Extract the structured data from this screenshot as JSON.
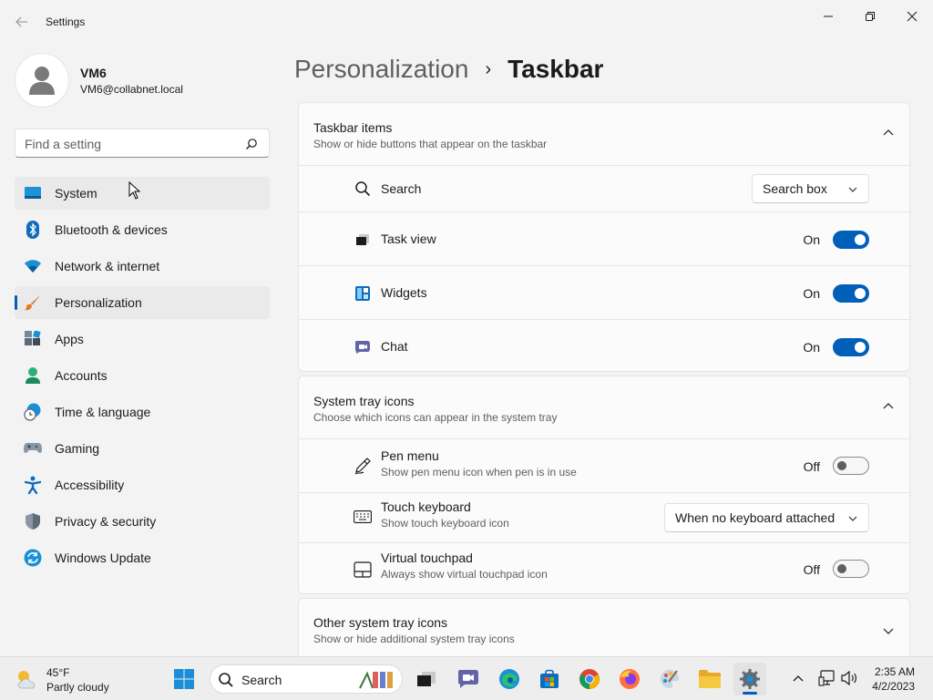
{
  "window": {
    "app_title": "Settings"
  },
  "profile": {
    "name": "VM6",
    "email": "VM6@collabnet.local"
  },
  "search": {
    "placeholder": "Find a setting"
  },
  "sidebar": {
    "items": [
      {
        "label": "System",
        "icon": "system-icon",
        "state": "hover"
      },
      {
        "label": "Bluetooth & devices",
        "icon": "bluetooth-icon"
      },
      {
        "label": "Network & internet",
        "icon": "wifi-icon"
      },
      {
        "label": "Personalization",
        "icon": "brush-icon",
        "state": "selected"
      },
      {
        "label": "Apps",
        "icon": "apps-icon"
      },
      {
        "label": "Accounts",
        "icon": "accounts-icon"
      },
      {
        "label": "Time & language",
        "icon": "globe-clock-icon"
      },
      {
        "label": "Gaming",
        "icon": "gamepad-icon"
      },
      {
        "label": "Accessibility",
        "icon": "accessibility-icon"
      },
      {
        "label": "Privacy & security",
        "icon": "shield-icon"
      },
      {
        "label": "Windows Update",
        "icon": "update-icon"
      }
    ]
  },
  "breadcrumb": {
    "parent": "Personalization",
    "separator": "›",
    "current": "Taskbar"
  },
  "taskbar_items": {
    "title": "Taskbar items",
    "description": "Show or hide buttons that appear on the taskbar",
    "rows": [
      {
        "label": "Search",
        "icon": "search-icon",
        "control": "dropdown",
        "value": "Search box"
      },
      {
        "label": "Task view",
        "icon": "task-view-icon",
        "control": "toggle",
        "state_label": "On",
        "on": true
      },
      {
        "label": "Widgets",
        "icon": "widgets-icon",
        "control": "toggle",
        "state_label": "On",
        "on": true
      },
      {
        "label": "Chat",
        "icon": "chat-icon",
        "control": "toggle",
        "state_label": "On",
        "on": true
      }
    ]
  },
  "system_tray": {
    "title": "System tray icons",
    "description": "Choose which icons can appear in the system tray",
    "rows": [
      {
        "label": "Pen menu",
        "sub": "Show pen menu icon when pen is in use",
        "icon": "pen-icon",
        "control": "toggle",
        "state_label": "Off",
        "on": false
      },
      {
        "label": "Touch keyboard",
        "sub": "Show touch keyboard icon",
        "icon": "keyboard-icon",
        "control": "dropdown",
        "value": "When no keyboard attached"
      },
      {
        "label": "Virtual touchpad",
        "sub": "Always show virtual touchpad icon",
        "icon": "touchpad-icon",
        "control": "toggle",
        "state_label": "Off",
        "on": false
      }
    ]
  },
  "other_tray": {
    "title": "Other system tray icons",
    "description": "Show or hide additional system tray icons"
  },
  "taskbar": {
    "weather_temp": "45°F",
    "weather_desc": "Partly cloudy",
    "search_label": "Search",
    "time": "2:35 AM",
    "date": "4/2/2023"
  },
  "colors": {
    "accent": "#005fb8",
    "background": "#f3f3f3",
    "card": "#fbfbfb"
  }
}
